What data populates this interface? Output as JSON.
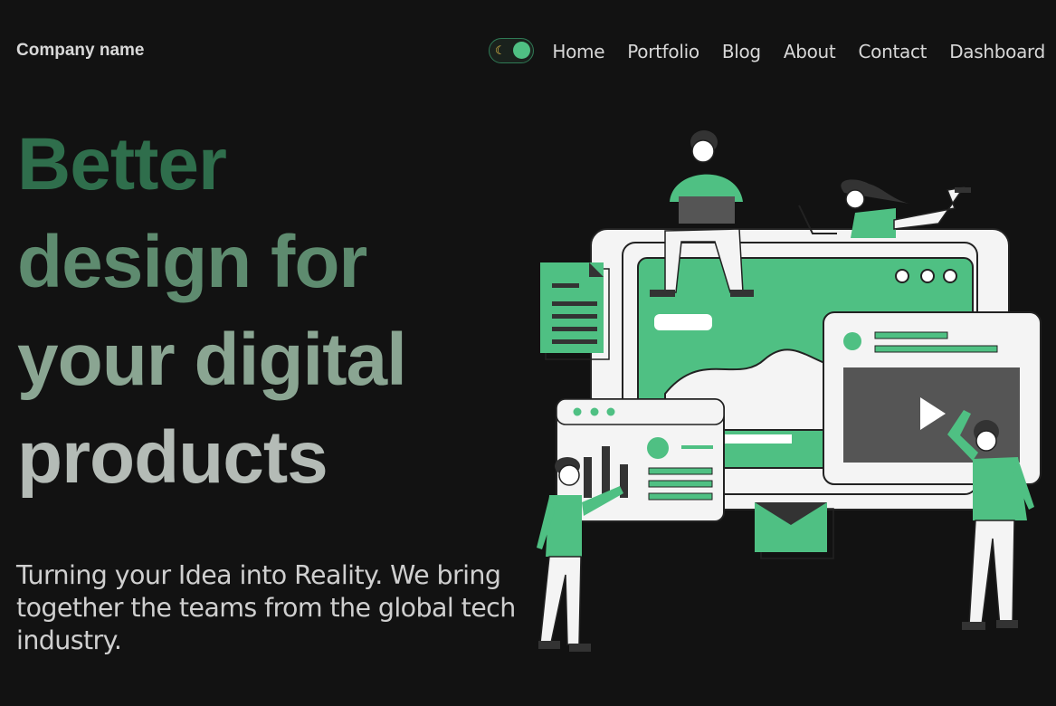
{
  "brand": {
    "name": "Company name"
  },
  "theme_toggle": {
    "icon": "moon-icon",
    "state": "dark",
    "accent": "#4fc083"
  },
  "nav": {
    "items": [
      {
        "label": "Home"
      },
      {
        "label": "Portfolio"
      },
      {
        "label": "Blog"
      },
      {
        "label": "About"
      },
      {
        "label": "Contact"
      },
      {
        "label": "Dashboard"
      }
    ]
  },
  "hero": {
    "headline_lines": [
      "Better",
      "design for",
      "your digital",
      "products"
    ],
    "subtext": "Turning your Idea into Reality. We bring together the teams from the global tech industry.",
    "illustration": "team-building-digital-product-illustration"
  },
  "colors": {
    "background": "#121212",
    "accent_green": "#4fc083",
    "heading_dark_green": "#2f6e4c"
  }
}
